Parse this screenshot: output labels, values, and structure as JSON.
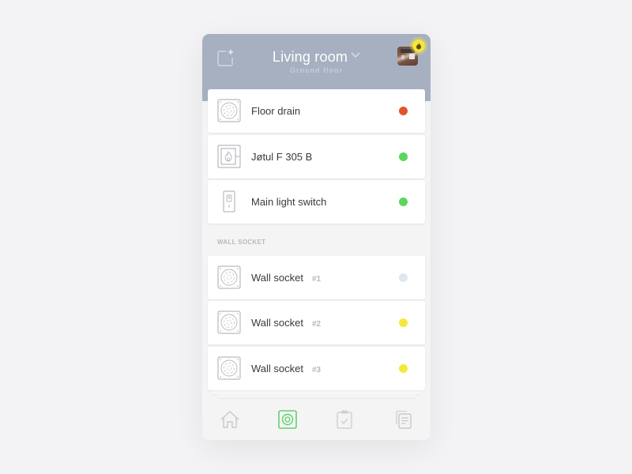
{
  "header": {
    "title": "Living room",
    "subtitle": "Ground floor",
    "add_icon": "add-widget-icon",
    "dropdown_icon": "chevron-down-icon",
    "avatar_alt": "home-photo",
    "badge_icon": "flame-icon",
    "badge_color": "#f7e53a"
  },
  "devices": [
    {
      "name": "Floor drain",
      "icon": "floor-drain-icon",
      "status_color": "#e4532f"
    },
    {
      "name": "Jøtul F 305 B",
      "icon": "fireplace-icon",
      "status_color": "#5cd65c"
    },
    {
      "name": "Main light switch",
      "icon": "light-switch-icon",
      "status_color": "#5cd65c"
    }
  ],
  "section": {
    "label": "WALL SOCKET",
    "items": [
      {
        "name": "Wall socket",
        "number": "#1",
        "icon": "wall-socket-icon",
        "status_color": "#e1e6ee"
      },
      {
        "name": "Wall socket",
        "number": "#2",
        "icon": "wall-socket-icon",
        "status_color": "#f4e83c"
      },
      {
        "name": "Wall socket",
        "number": "#3",
        "icon": "wall-socket-icon",
        "status_color": "#f4e83c"
      }
    ]
  },
  "tabbar": {
    "active_color": "#5ed36a",
    "inactive_color": "#c8c8cc",
    "tabs": [
      {
        "name": "home",
        "icon": "home-icon",
        "active": false
      },
      {
        "name": "devices",
        "icon": "device-icon",
        "active": true
      },
      {
        "name": "tasks",
        "icon": "clipboard-check-icon",
        "active": false
      },
      {
        "name": "documents",
        "icon": "documents-icon",
        "active": false
      }
    ]
  }
}
